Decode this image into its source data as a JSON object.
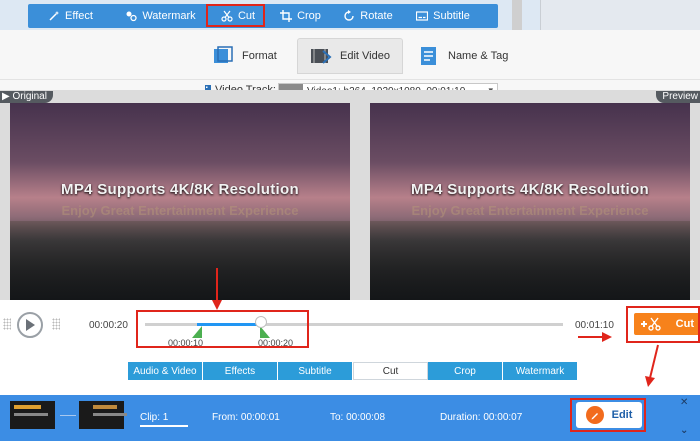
{
  "toolbar": {
    "items": [
      {
        "label": "Effect",
        "icon": "magic-wand-icon"
      },
      {
        "label": "Watermark",
        "icon": "watermark-icon"
      },
      {
        "label": "Cut",
        "icon": "scissors-icon"
      },
      {
        "label": "Crop",
        "icon": "crop-icon"
      },
      {
        "label": "Rotate",
        "icon": "rotate-icon"
      },
      {
        "label": "Subtitle",
        "icon": "subtitle-icon"
      }
    ],
    "active": "Cut"
  },
  "header_tabs": [
    {
      "label": "Format",
      "icon": "format-icon"
    },
    {
      "label": "Edit Video",
      "icon": "edit-video-icon"
    },
    {
      "label": "Name & Tag",
      "icon": "name-tag-icon"
    }
  ],
  "video_track": {
    "label": "Video Track:",
    "value": "Video1: h264, 1920x1080, 00:01:10"
  },
  "preview": {
    "left_label": "Original",
    "right_label": "Preview",
    "caption": "MP4 Supports 4K/8K Resolution",
    "subcaption": "Enjoy Great Entertainment Experience"
  },
  "timeline": {
    "start_time": "00:00:20",
    "end_time": "00:01:10",
    "marker_start": "00:00:10",
    "marker_end": "00:00:20",
    "cut_label": "Cut"
  },
  "subtabs": [
    "Audio & Video",
    "Effects",
    "Subtitle",
    "Cut",
    "Crop",
    "Watermark"
  ],
  "subtabs_active": "Cut",
  "clip": {
    "clip_label": "Clip:",
    "clip_value": "1",
    "from_label": "From:",
    "from_value": "00:00:01",
    "to_label": "To:",
    "to_value": "00:00:08",
    "duration_label": "Duration:",
    "duration_value": "00:00:07",
    "edit_label": "Edit"
  },
  "colors": {
    "accent_blue": "#3b8fd9",
    "cut_orange": "#f7821b",
    "annotation_red": "#e0251b",
    "handle_green": "#4caf50"
  }
}
